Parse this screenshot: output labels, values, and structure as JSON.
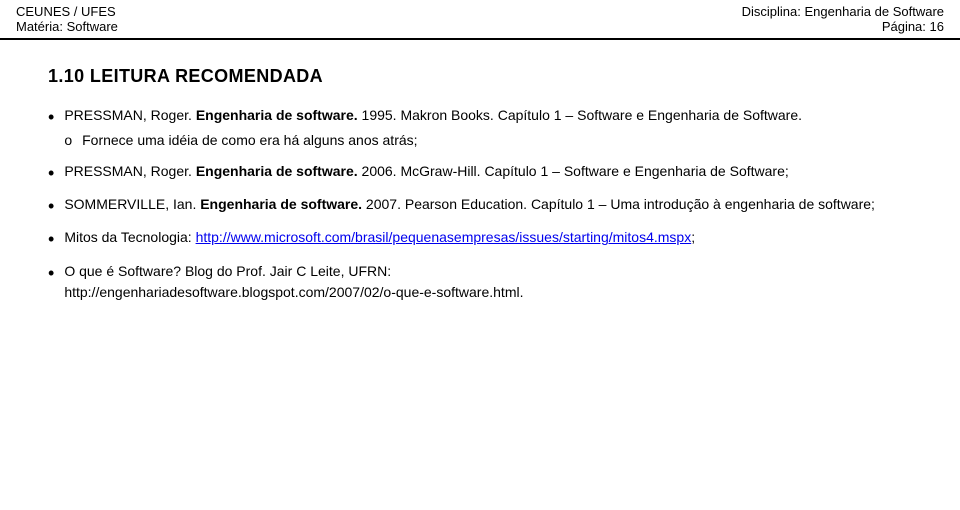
{
  "header": {
    "institution": "CEUNES / UFES",
    "subject_label": "Matéria:",
    "subject": "Software",
    "discipline_label": "Disciplina:",
    "discipline": "Engenharia de Software",
    "page_label": "Página:",
    "page_number": "16"
  },
  "section": {
    "number": "1.10",
    "title": "Leitura Recomendada"
  },
  "items": [
    {
      "id": "item1",
      "text_parts": [
        {
          "text": "PRESSMAN, Roger. ",
          "bold": false
        },
        {
          "text": "Engenharia de software.",
          "bold": true
        },
        {
          "text": " 1995. Makron Books. Capítulo 1 – Software e Engenharia de Software.",
          "bold": false
        }
      ],
      "sub_items": [
        {
          "bullet": "o",
          "text": "Fornece uma idéia de como era há alguns anos atrás;"
        }
      ]
    },
    {
      "id": "item2",
      "text_parts": [
        {
          "text": "PRESSMAN, Roger. ",
          "bold": false
        },
        {
          "text": "Engenharia de software.",
          "bold": true
        },
        {
          "text": " 2006. McGraw-Hill. Capítulo 1 – Software e Engenharia de Software;",
          "bold": false
        }
      ],
      "sub_items": []
    },
    {
      "id": "item3",
      "text_parts": [
        {
          "text": "SOMMERVILLE, Ian. ",
          "bold": false
        },
        {
          "text": "Engenharia de software.",
          "bold": true
        },
        {
          "text": " 2007.  Pearson Education. Capítulo 1 – Uma introdução à engenharia de software;",
          "bold": false
        }
      ],
      "sub_items": []
    },
    {
      "id": "item4",
      "text_parts": [
        {
          "text": "Mitos da Tecnologia: ",
          "bold": false
        }
      ],
      "link_text": "http://www.microsoft.com/brasil/pequenasempresas/issues/starting/mitos4.mspx",
      "link_suffix": ";",
      "sub_items": []
    },
    {
      "id": "item5",
      "text_parts": [
        {
          "text": "O que é Software? Blog do Prof. Jair C Leite, UFRN:",
          "bold": false
        }
      ],
      "second_line": "http://engenhariadesoftware.blogspot.com/2007/02/o-que-e-software.html.",
      "second_line_plain": true,
      "sub_items": []
    }
  ]
}
